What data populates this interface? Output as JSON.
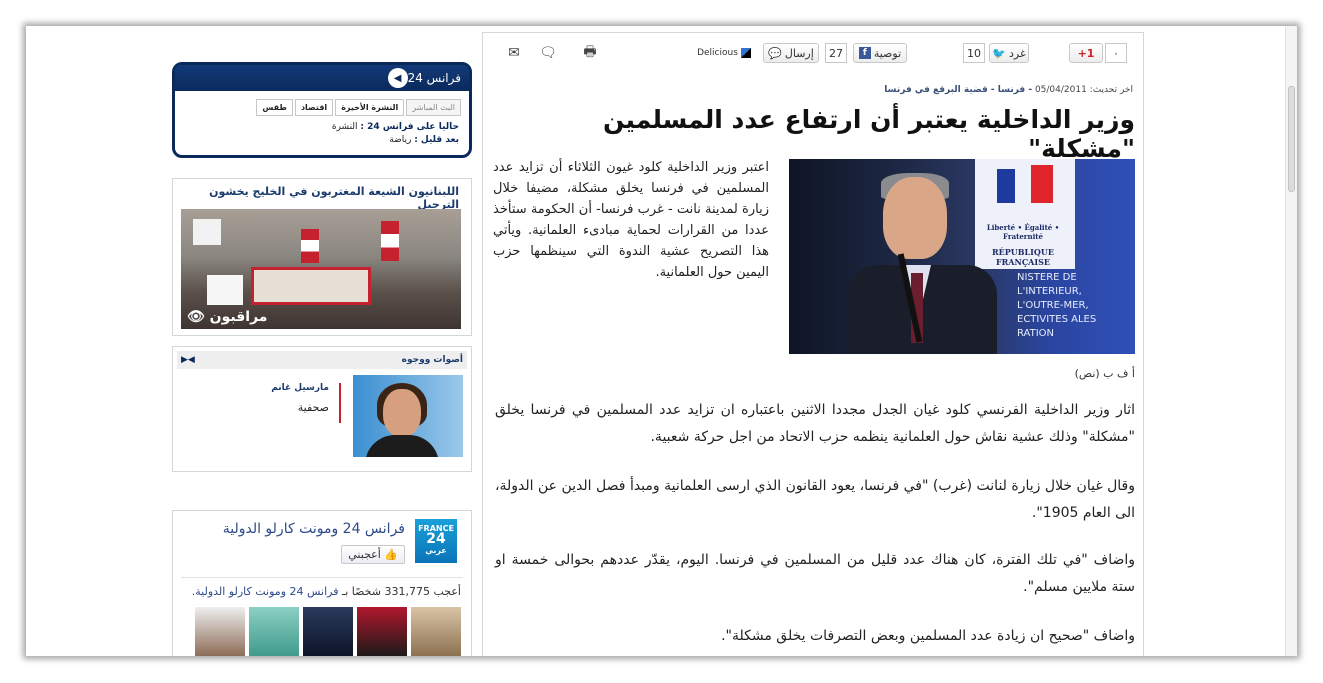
{
  "toolbar": {
    "gplus_count": "٠",
    "gplus_label": "+1",
    "tweet_label": "غرد",
    "tweet_count": "10",
    "fb_label": "توصية",
    "fb_count": "27",
    "send_label": "إرسال",
    "delicious_label": "Delicious"
  },
  "article": {
    "updated_label": "اخر تحديث:",
    "updated_date": "05/04/2011",
    "breadcrumb": "- فرنسا - قضية البرقع في فرنسا",
    "headline": "وزير الداخلية يعتبر أن ارتفاع عدد المسلمين \"مشكلة\"",
    "lead": "اعتبر وزير الداخلية كلود غيون الثلاثاء أن تزايد عدد المسلمين في فرنسا يخلق مشكلة، مضيفا خلال زيارة لمدينة نانت - غرب فرنسا- أن الحكومة ستأخذ عددا من القرارات لحماية مبادىء العلمانية. ويأتي هذا التصريح عشية الندوة التي سينظمها حزب اليمين حول العلمانية.",
    "photo_caption": "أ ف ب (نص)",
    "photo_text": "Liberté • Égalité • Fraternité",
    "photo_text2": "RÉPUBLIQUE FRANÇAISE",
    "photo_text3": "NISTERE DE L'INTERIEUR, L'OUTRE-MER, ECTIVITES ALES RATION",
    "paragraphs": [
      "اثار وزير الداخلية الفرنسي كلود غيان الجدل مجددا الاثنين باعتباره ان تزايد عدد المسلمين في فرنسا يخلق \"مشكلة\" وذلك عشية نقاش حول العلمانية ينظمه حزب الاتحاد من اجل حركة شعبية.",
      "وقال غيان خلال زيارة لنانت (غرب) \"في فرنسا، يعود القانون الذي ارسى العلمانية ومبدأ فصل الدين عن الدولة، الى العام 1905\".",
      "واضاف \"في تلك الفترة، كان هناك عدد قليل من المسلمين في فرنسا. اليوم، يقدّر عددهم بحوالى خمسة او ستة ملايين مسلم\".",
      "واضاف \"صحيح ان زيادة عدد المسلمين وبعض التصرفات يخلق مشكلة\"."
    ]
  },
  "tv": {
    "title": "فرانس 24",
    "tabs": [
      "البث المباشر",
      "النشرة الأخيرة",
      "اقتصاد",
      "طقس"
    ],
    "now_label": "حاليا على فرانس 24 :",
    "now_value": "النشرة",
    "next_label": "بعد قليل :",
    "next_value": "رياضة"
  },
  "news": {
    "title": "اللبنانيون الشيعة المغتربون في الخليج يخشون الترحيل",
    "logo": "مراقبون"
  },
  "voices": {
    "title": "أصوات ووجوه",
    "arrows": "◀▶",
    "name": "مارسيل غانم",
    "role": "صحفية"
  },
  "fb": {
    "logo_top": "FRANCE",
    "logo_mid": "24",
    "logo_bottom": "عربي",
    "page_name": "فرانس 24 ومونت كارلو الدولية",
    "like_label": "أعجبني",
    "count_text": "أعجب 331,775 شخصًا بـ",
    "count_link": "فرانس 24 ومونت كارلو الدولية."
  }
}
